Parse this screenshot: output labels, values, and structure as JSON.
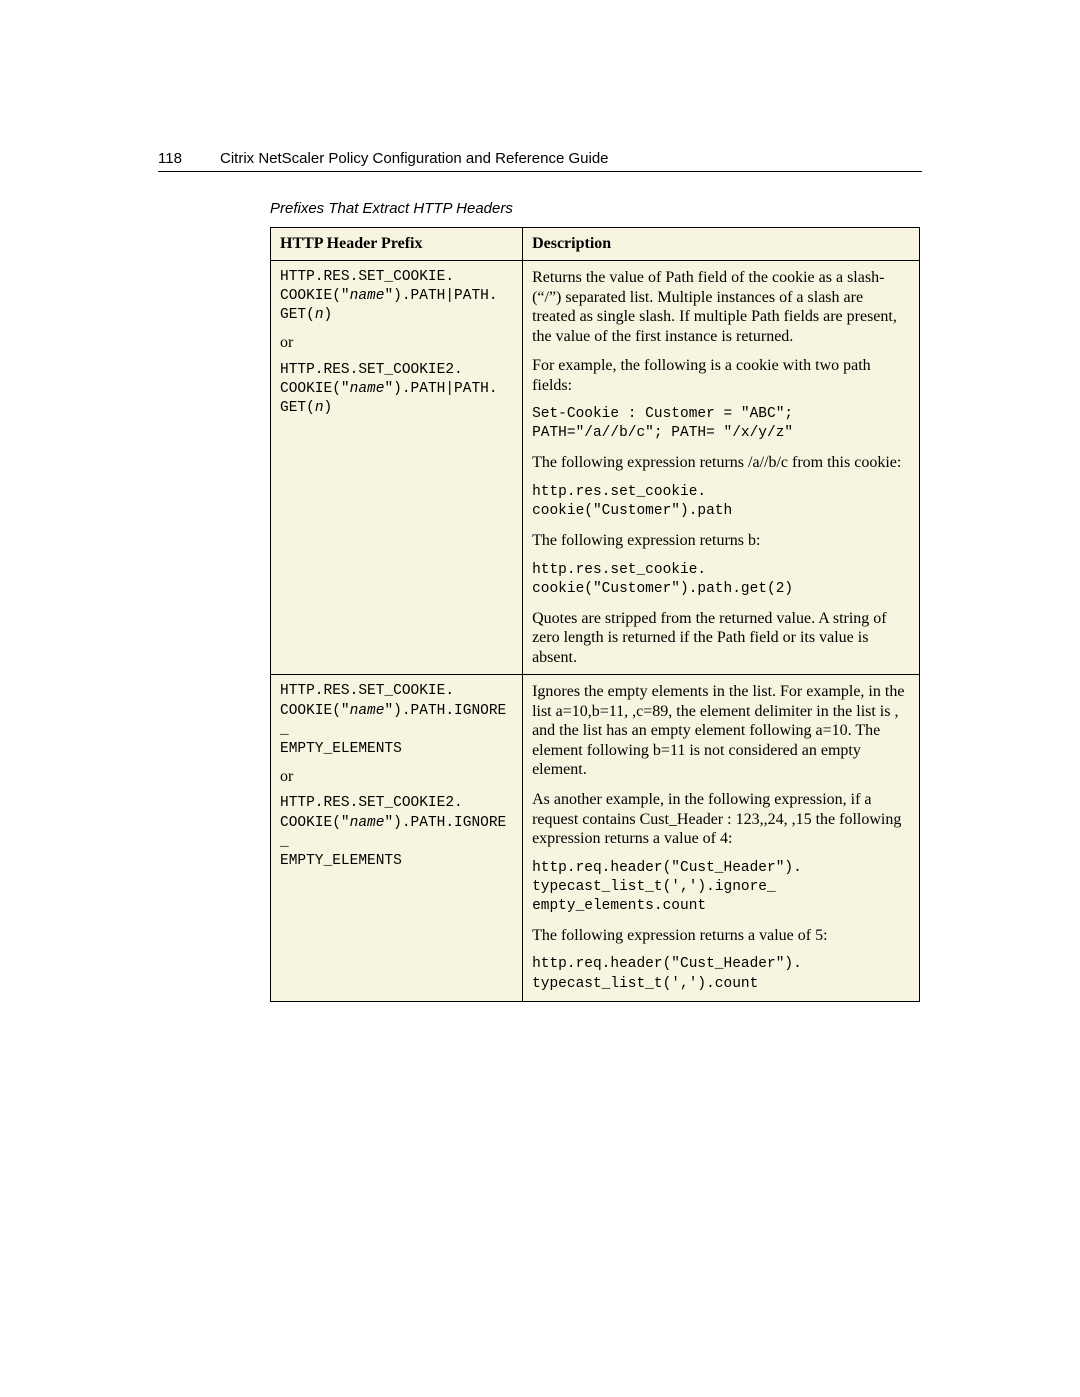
{
  "header": {
    "pageNumber": "118",
    "title": "Citrix NetScaler Policy Configuration and Reference Guide"
  },
  "table": {
    "caption": "Prefixes That Extract HTTP Headers",
    "headers": {
      "prefix": "HTTP Header Prefix",
      "description": "Description"
    },
    "rows": [
      {
        "prefix": {
          "line1a": "HTTP.RES.SET_COOKIE.",
          "line1b_pre": "COOKIE(\"",
          "line1b_it": "name",
          "line1b_post": "\").PATH|PATH.",
          "line1c_pre": "GET(",
          "line1c_it": "n",
          "line1c_post": ")",
          "or": "or",
          "line2a": "HTTP.RES.SET_COOKIE2.",
          "line2b_pre": "COOKIE(\"",
          "line2b_it": "name",
          "line2b_post": "\").PATH|PATH.",
          "line2c_pre": "GET(",
          "line2c_it": "n",
          "line2c_post": ")"
        },
        "desc": {
          "p1": "Returns the value of Path field of the cookie as a slash- (“/”) separated list. Multiple instances of a slash are treated as single slash. If multiple Path fields are present, the value of the first instance is returned.",
          "p2": "For example, the following is a cookie with two path fields:",
          "code1a": "Set-Cookie : Customer = \"ABC\";",
          "code1b": "PATH=\"/a//b/c\"; PATH= \"/x/y/z\"",
          "p3": "The following expression returns /a//b/c from this cookie:",
          "code2a": "http.res.set_cookie.",
          "code2b": "cookie(\"Customer\").path",
          "p4": "The following expression returns b:",
          "code3a": "http.res.set_cookie.",
          "code3b": "cookie(\"Customer\").path.get(2)",
          "p5": "Quotes are stripped from the returned value. A string of zero length is returned if the Path field or its value is absent."
        }
      },
      {
        "prefix": {
          "line1a": "HTTP.RES.SET_COOKIE.",
          "line1b_pre": "COOKIE(\"",
          "line1b_it": "name",
          "line1b_post": "\").PATH.IGNORE_",
          "line1c": "EMPTY_ELEMENTS",
          "or": "or",
          "line2a": "HTTP.RES.SET_COOKIE2.",
          "line2b_pre": "COOKIE(\"",
          "line2b_it": "name",
          "line2b_post": "\").PATH.IGNORE_",
          "line2c": "EMPTY_ELEMENTS"
        },
        "desc": {
          "p1": "Ignores the empty elements in the list. For example, in the list a=10,b=11, ,c=89, the element delimiter in the list is , and the list has an empty element following a=10. The element following b=11 is not considered an empty element.",
          "p2": "As another example, in the following expression, if a request contains Cust_Header : 123,,24, ,15 the following expression returns a value of 4:",
          "code1a": "http.req.header(\"Cust_Header\").",
          "code1b": "typecast_list_t(',').ignore_",
          "code1c": "empty_elements.count",
          "p3": "The following expression returns a value of 5:",
          "code2a": "http.req.header(\"Cust_Header\").",
          "code2b": "typecast_list_t(',').count"
        }
      }
    ]
  }
}
